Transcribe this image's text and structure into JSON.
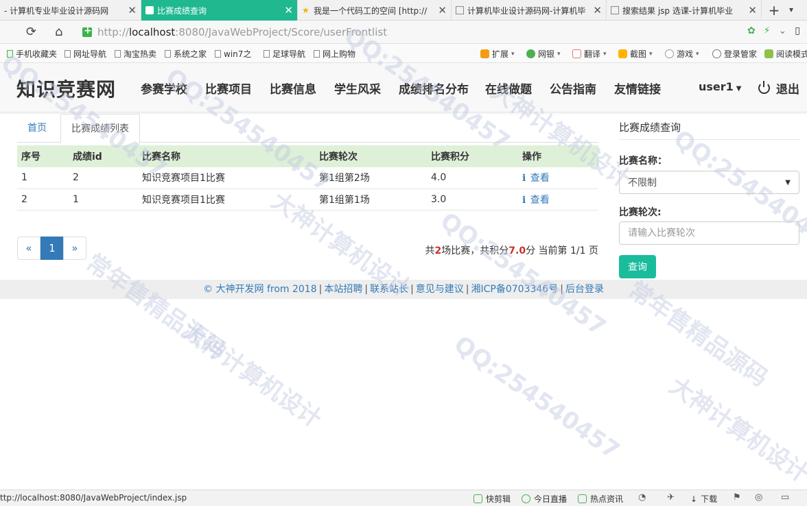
{
  "browser": {
    "tabs": [
      {
        "title": "- 计算机专业毕业设计源码网",
        "active": false
      },
      {
        "title": "比赛成绩查询",
        "active": true
      },
      {
        "title": "我是一个代码工的空间 [http://",
        "active": false
      },
      {
        "title": "计算机毕业设计源码网-计算机毕",
        "active": false
      },
      {
        "title": "搜索结果 jsp 选课-计算机毕业",
        "active": false
      }
    ],
    "url_prefix": "http://",
    "url_host": "localhost",
    "url_rest": ":8080/JavaWebProject/Score/userFrontlist",
    "bookmarks": [
      "手机收藏夹",
      "网址导航",
      "淘宝热卖",
      "系统之家",
      "win7之",
      "足球导航",
      "网上购物"
    ],
    "tools": [
      "扩展",
      "网银",
      "翻译",
      "截图",
      "游戏",
      "登录管家",
      "阅读模式"
    ],
    "status_url": "ttp://localhost:8080/JavaWebProject/index.jsp",
    "status_tools": [
      "快剪辑",
      "今日直播",
      "热点资讯",
      "下载"
    ]
  },
  "site": {
    "brand": "知识竞赛网",
    "nav": [
      "参赛学校",
      "比赛项目",
      "比赛信息",
      "学生风采",
      "成绩排名分布",
      "在线做题",
      "公告指南",
      "友情链接"
    ],
    "user": "user1",
    "logout": "退出"
  },
  "main": {
    "breadcrumb_tabs": [
      "首页",
      "比赛成绩列表"
    ],
    "table": {
      "headers": [
        "序号",
        "成绩id",
        "比赛名称",
        "比赛轮次",
        "比赛积分",
        "操作"
      ],
      "rows": [
        [
          "1",
          "2",
          "知识竞赛项目1比赛",
          "第1组第2场",
          "4.0",
          "查看"
        ],
        [
          "2",
          "1",
          "知识竞赛项目1比赛",
          "第1组第1场",
          "3.0",
          "查看"
        ]
      ]
    },
    "pager": {
      "prev": "«",
      "current": "1",
      "next": "»"
    },
    "summary": {
      "p1": "共",
      "count": "2",
      "p2": "场比赛，共积分",
      "total": "7.0",
      "p3": "分 当前第 1/1 页"
    }
  },
  "filter": {
    "title": "比赛成绩查询",
    "name_label": "比赛名称：",
    "name_value": "不限制",
    "round_label": "比赛轮次:",
    "round_placeholder": "请输入比赛轮次",
    "button": "查询"
  },
  "footer": {
    "links": [
      "© 大神开发网 from 2018",
      "本站招聘",
      "联系站长",
      "意见与建议",
      "湘ICP备0703346号",
      "后台登录"
    ]
  },
  "watermark": {
    "texts": [
      "QQ:254540457",
      "大神计算机设计",
      "常年售精品源码"
    ]
  },
  "colors": {
    "active_tab": "#1fb88f",
    "link": "#337ab7",
    "table_header": "#dff0d8",
    "query_button": "#1abc9c",
    "highlight": "#c9302c"
  }
}
